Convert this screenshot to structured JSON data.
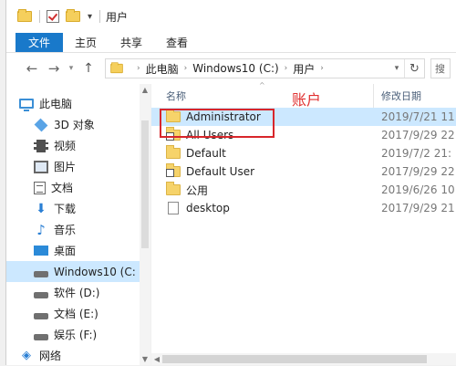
{
  "titlebar": {
    "title": "用户"
  },
  "ribbon": {
    "tabs": [
      "文件",
      "主页",
      "共享",
      "查看"
    ]
  },
  "address": {
    "crumbs": [
      "此电脑",
      "Windows10 (C:)",
      "用户"
    ],
    "search_placeholder": "搜"
  },
  "nav": {
    "items": [
      {
        "label": "此电脑",
        "icon": "computer-icon",
        "top": true
      },
      {
        "label": "3D 对象",
        "icon": "3d-objects-icon"
      },
      {
        "label": "视频",
        "icon": "video-icon"
      },
      {
        "label": "图片",
        "icon": "pictures-icon"
      },
      {
        "label": "文档",
        "icon": "documents-icon"
      },
      {
        "label": "下载",
        "icon": "downloads-icon"
      },
      {
        "label": "音乐",
        "icon": "music-icon"
      },
      {
        "label": "桌面",
        "icon": "desktop-icon"
      },
      {
        "label": "Windows10 (C:",
        "icon": "drive-icon",
        "selected": true
      },
      {
        "label": "软件 (D:)",
        "icon": "drive-icon"
      },
      {
        "label": "文档 (E:)",
        "icon": "drive-icon"
      },
      {
        "label": "娱乐 (F:)",
        "icon": "drive-icon"
      },
      {
        "label": "网络",
        "icon": "network-icon",
        "top": true
      }
    ]
  },
  "columns": {
    "name": "名称",
    "date": "修改日期"
  },
  "annotation": "账户",
  "files": [
    {
      "name": "Administrator",
      "date": "2019/7/21 11",
      "type": "folder",
      "selected": true
    },
    {
      "name": "All Users",
      "date": "2017/9/29 22",
      "type": "shortcut"
    },
    {
      "name": "Default",
      "date": "2019/7/2 21:",
      "type": "folder"
    },
    {
      "name": "Default User",
      "date": "2017/9/29 22",
      "type": "shortcut"
    },
    {
      "name": "公用",
      "date": "2019/6/26 10",
      "type": "folder"
    },
    {
      "name": "desktop",
      "date": "2017/9/29 21",
      "type": "file"
    }
  ],
  "colors": {
    "accent": "#1979ca",
    "selection": "#cce8ff",
    "highlight": "#d8262b"
  }
}
